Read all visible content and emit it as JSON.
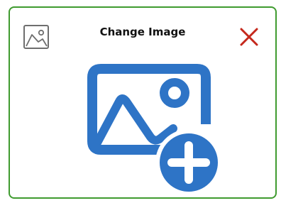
{
  "dialog": {
    "title": "Change Image"
  },
  "icons": {
    "header_icon": "image-icon",
    "close": "close-icon",
    "main": "add-image-icon"
  },
  "colors": {
    "border": "#3f9b2f",
    "accent_blue": "#2e74c6",
    "close_red": "#c5281c",
    "thumb_gray": "#6e6e6e"
  }
}
